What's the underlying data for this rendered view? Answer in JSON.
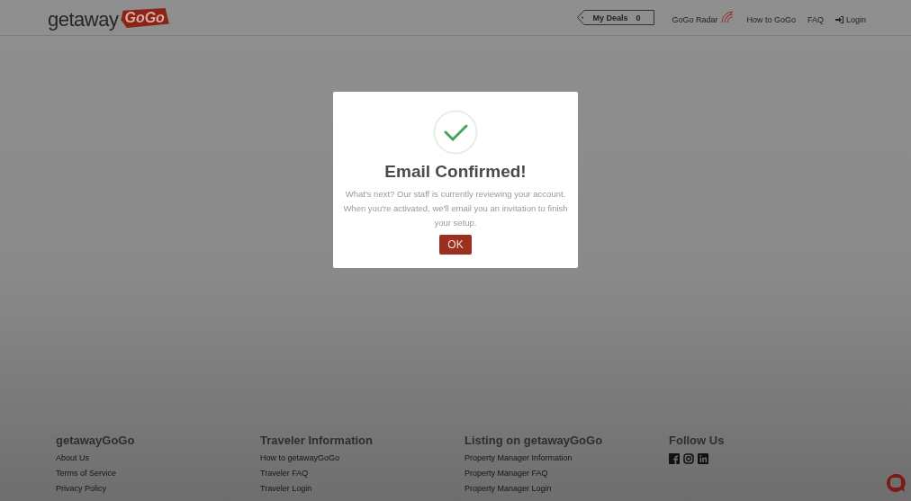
{
  "header": {
    "logo": {
      "text": "getaway",
      "tag": "GoGo"
    },
    "my_deals": {
      "label": "My Deals",
      "count": "0"
    },
    "nav": [
      {
        "kind": "radar",
        "label": "GoGo Radar"
      },
      {
        "kind": "plain",
        "label": "How to GoGo"
      },
      {
        "kind": "plain",
        "label": "FAQ"
      },
      {
        "kind": "login",
        "label": "Login"
      }
    ]
  },
  "dialog": {
    "title": "Email Confirmed!",
    "message": "What's next? Our staff is currently reviewing your account. When you're activated, we'll email you an invitation to finish your setup.",
    "button": "OK"
  },
  "footer": {
    "columns": [
      {
        "kind": "links",
        "heading": "getawayGoGo",
        "links": [
          "About Us",
          "Terms of Service",
          "Privacy Policy"
        ]
      },
      {
        "kind": "links",
        "heading": "Traveler Information",
        "links": [
          "How to getawayGoGo",
          "Traveler FAQ",
          "Traveler Login"
        ]
      },
      {
        "kind": "links",
        "heading": "Listing on getawayGoGo",
        "links": [
          "Property Manager Information",
          "Property Manager FAQ",
          "Property Manager Login"
        ]
      },
      {
        "kind": "social",
        "heading": "Follow Us"
      }
    ]
  }
}
